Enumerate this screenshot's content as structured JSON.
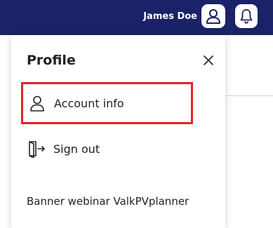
{
  "header": {
    "user_name": "James Doe"
  },
  "profile_panel": {
    "title": "Profile",
    "items": [
      {
        "label": "Account info",
        "icon": "user-icon"
      },
      {
        "label": "Sign out",
        "icon": "sign-out-icon"
      }
    ],
    "banner_link": "Banner webinar ValkPVplanner"
  },
  "colors": {
    "topbar": "#1b2268",
    "highlight": "#e02424"
  }
}
